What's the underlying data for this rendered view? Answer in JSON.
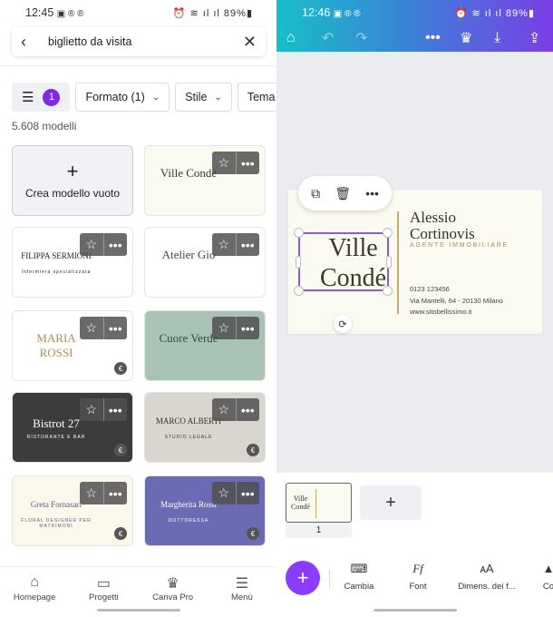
{
  "left": {
    "status": {
      "time": "12:45",
      "notif_icons": "▣ ® ®",
      "battery": "89%"
    },
    "search": {
      "query": "biglietto da visita"
    },
    "filters": {
      "badge_count": "1",
      "chips": [
        "Formato (1)",
        "Stile",
        "Tema"
      ]
    },
    "result_count": "5.608 modelli",
    "create_blank_label": "Crea modello vuoto",
    "templates": [
      {
        "name": "Ville Condé",
        "bg": "#fbfaf0",
        "fg": "#3a3a2a",
        "pro": false
      },
      {
        "name": "FILIPPA SERMIONI",
        "sub": "Infermiera specializzata",
        "bg": "#ffffff",
        "fg": "#222222",
        "pro": false
      },
      {
        "name": "Atelier Gio",
        "bg": "#ffffff",
        "fg": "#5a3a4a",
        "pro": false
      },
      {
        "name": "MARIA ROSSI",
        "bg": "#ffffff",
        "fg": "#a8905a",
        "pro": true
      },
      {
        "name": "Cuore Verde",
        "bg": "#a9c4b6",
        "fg": "#2f4a3c",
        "pro": false
      },
      {
        "name": "Bistrot 27",
        "sub": "RISTORANTE E BAR",
        "bg": "#3c3c3c",
        "fg": "#ffffff",
        "pro": true
      },
      {
        "name": "MARCO ALBERTI",
        "sub": "STUDIO LEGALE",
        "bg": "#d9d6d0",
        "fg": "#333333",
        "pro": true
      },
      {
        "name": "Greta Fornasari",
        "sub": "FLORAL DESIGNER PER MATRIMONI",
        "bg": "#fbf7ea",
        "fg": "#6b5b7a",
        "pro": true
      },
      {
        "name": "Margherita Rossi",
        "sub": "DOTTORESSA",
        "bg": "#6a6ab5",
        "fg": "#ffffff",
        "pro": true
      }
    ],
    "nav": [
      {
        "label": "Homepage",
        "icon": "home-icon"
      },
      {
        "label": "Progetti",
        "icon": "folder-icon"
      },
      {
        "label": "Canva Pro",
        "icon": "crown-icon"
      },
      {
        "label": "Menù",
        "icon": "menu-icon"
      }
    ]
  },
  "right": {
    "status": {
      "time": "12:46",
      "notif_icons": "▣ ® ®",
      "battery": "89%"
    },
    "card": {
      "logo_line1": "Ville",
      "logo_line2": "Condé",
      "name_line1": "Alessio",
      "name_line2": "Cortinovis",
      "role": "AGENTE IMMOBILIARE",
      "phone": "0123 123456",
      "address": "Via Mantelli, 64 - 20130 Milano",
      "website": "www.sitobellissimo.it"
    },
    "page_number": "1",
    "tools": [
      "Cambia",
      "Font",
      "Dimens. dei f...",
      "Co"
    ],
    "accent": "#8b3dff"
  }
}
